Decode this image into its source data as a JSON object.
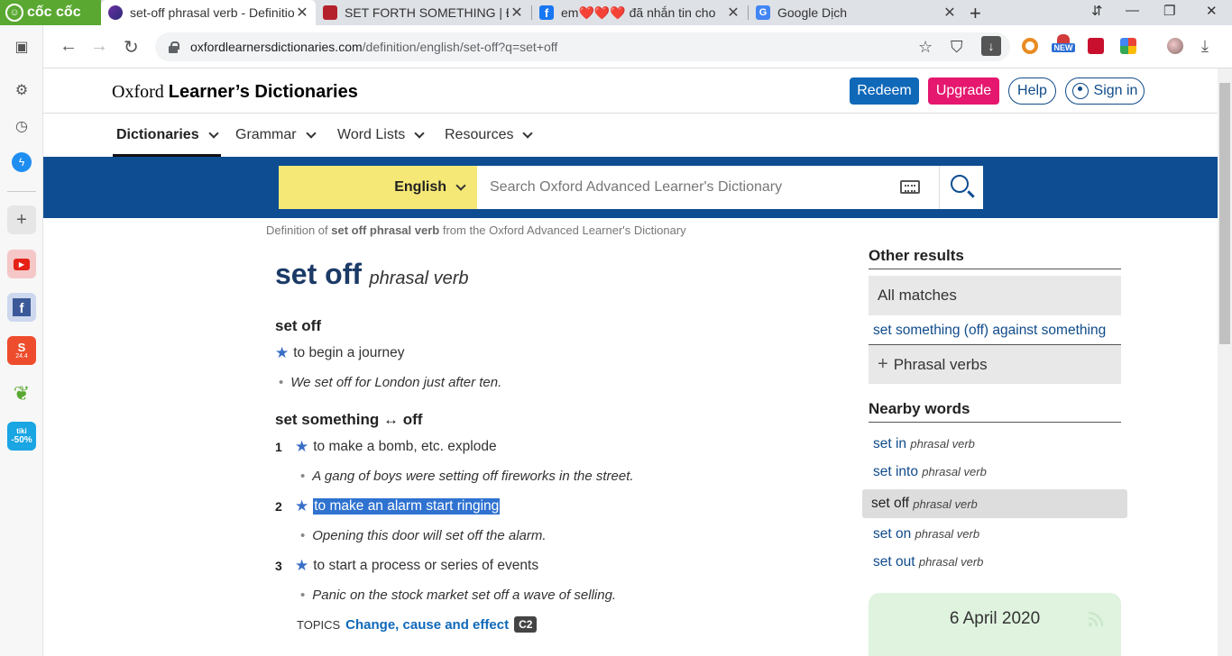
{
  "browser": {
    "brand": "cốc cốc",
    "tabs": [
      {
        "title": "set-off phrasal verb - Definitio",
        "active": true
      },
      {
        "title": "SET FORTH SOMETHING | Địn",
        "active": false
      },
      {
        "title": "em❤️❤️❤️ đã nhắn tin cho",
        "active": false
      },
      {
        "title": "Google Dịch",
        "active": false
      }
    ],
    "url_domain": "oxfordlearnersdictionaries.com",
    "url_path": "/definition/english/set-off?q=set+off",
    "ext_new_label": "NEW"
  },
  "sidebar": {
    "tiki_label_1": "tiki",
    "tiki_label_2": "-50%",
    "shopee_label": "S",
    "shopee_date": "24.4"
  },
  "site": {
    "logo_serif": "Oxford",
    "logo_bold": "Learner’s Dictionaries",
    "redeem": "Redeem",
    "upgrade": "Upgrade",
    "help": "Help",
    "signin": "Sign in"
  },
  "nav": {
    "items": [
      {
        "label": "Dictionaries"
      },
      {
        "label": "Grammar"
      },
      {
        "label": "Word Lists"
      },
      {
        "label": "Resources"
      }
    ]
  },
  "search": {
    "language": "English",
    "placeholder": "Search Oxford Advanced Learner's Dictionary"
  },
  "source": {
    "prefix": "Definition of",
    "term": "set off phrasal verb",
    "suffix": "from the Oxford Advanced Learner's Dictionary"
  },
  "entry": {
    "headword": "set off",
    "pos": "phrasal verb",
    "sense1": {
      "title": "set off",
      "definition": "to begin a journey",
      "example": "We set off for London just after ten."
    },
    "sense2": {
      "title_a": "set something",
      "title_arrow": "↔",
      "title_b": "off",
      "defs": [
        {
          "num": "1",
          "definition": "to make a bomb, etc. explode",
          "example": "A gang of boys were setting off fireworks in the street."
        },
        {
          "num": "2",
          "definition": "to make an alarm start ringing",
          "example": "Opening this door will set off the alarm."
        },
        {
          "num": "3",
          "definition": "to start a process or series of events",
          "example": "Panic on the stock market set off a wave of selling."
        }
      ],
      "topics_label": "TOPICS",
      "topics_link": "Change, cause and effect",
      "topics_level": "C2"
    }
  },
  "right": {
    "other_results": "Other results",
    "all_matches": "All matches",
    "match_link": "set something (off) against something",
    "phrasal_verbs": "Phrasal verbs",
    "nearby_heading": "Nearby words",
    "nearby": [
      {
        "word": "set in",
        "pos": "phrasal verb"
      },
      {
        "word": "set into",
        "pos": "phrasal verb"
      },
      {
        "word": "set off",
        "pos": "phrasal verb"
      },
      {
        "word": "set on",
        "pos": "phrasal verb"
      },
      {
        "word": "set out",
        "pos": "phrasal verb"
      }
    ],
    "wotd_date": "6 April 2020"
  }
}
